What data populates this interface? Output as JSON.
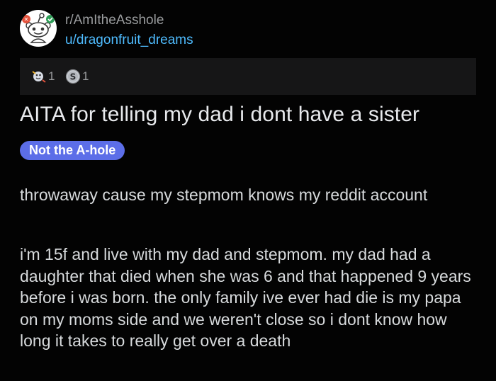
{
  "post": {
    "subreddit": "r/AmItheAsshole",
    "author": "u/dragonfruit_dreams",
    "awards": [
      {
        "icon": "award-icon",
        "count": "1"
      },
      {
        "icon": "silver-coin-icon",
        "count": "1"
      }
    ],
    "title": "AITA for telling my dad i dont have a sister",
    "flair": "Not the A-hole",
    "body": [
      "throwaway cause my stepmom knows my reddit account",
      "i'm 15f and live with my dad and stepmom. my dad had a daughter that died when she was 6 and that happened 9 years before i was born. the only family ive ever had die is my papa on my moms side and we weren't close so i dont know how long it takes to really get over a death"
    ]
  },
  "colors": {
    "background": "#030303",
    "subreddit_text": "#9a9c9e",
    "author_link": "#4fbcff",
    "flair_bg": "#5c6ee8",
    "awards_bar_bg": "#161617"
  }
}
